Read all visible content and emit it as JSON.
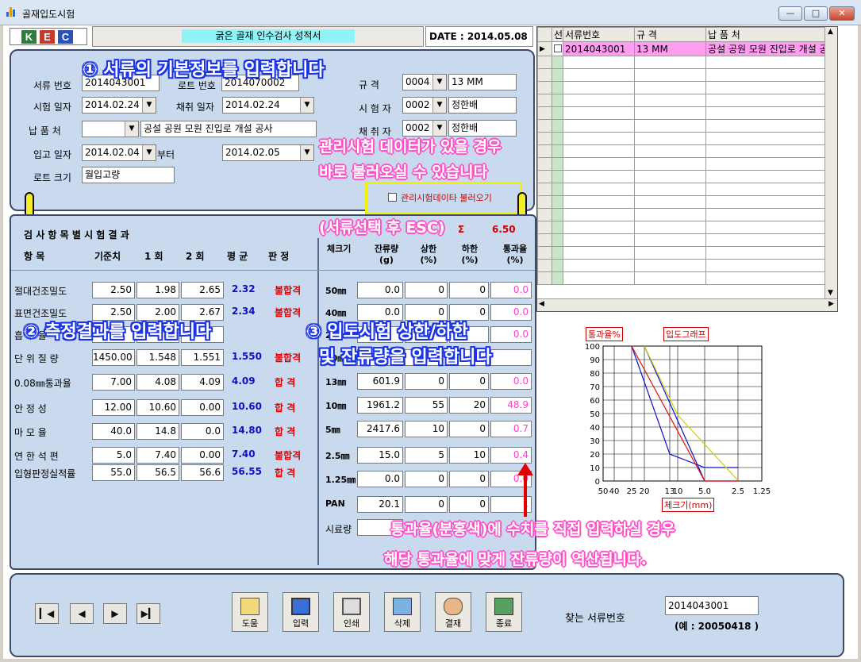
{
  "window": {
    "title": "골재입도시험",
    "btn_min": "—",
    "btn_max": "□",
    "btn_close": "✕"
  },
  "header": {
    "logo": [
      "K",
      "E",
      "C"
    ],
    "logo_colors": [
      "#2f7d3a",
      "#c43a2d",
      "#2b52b8"
    ],
    "title": "굵은 골재 인수검사 성적서",
    "date_label": "DATE : 2014.05.08"
  },
  "basic": {
    "doc_no_label": "서류 번호",
    "doc_no": "2014043001",
    "lot_no_label": "로트 번호",
    "lot_no": "2014070002",
    "test_date_label": "시험 일자",
    "test_date": "2014.02.24",
    "sample_date_label": "채취 일자",
    "sample_date": "2014.02.24",
    "supplier_label": "납 품 처",
    "supplier_code": "",
    "supplier_name": "공설 공원 모원 진입로 개설 공사",
    "in_date_label": "입고 일자",
    "in_date_from": "2014.02.04",
    "in_date_from_suffix": "부터",
    "in_date_to": "2014.02.05",
    "lot_size_label": "로트 크기",
    "lot_size": "월입고량",
    "spec_label": "규 격",
    "spec_code": "0004",
    "spec_name": "13 MM",
    "tester_label": "시 험 자",
    "tester_code": "0002",
    "tester_name": "정한배",
    "sampler_label": "채 취 자",
    "sampler_code": "0002",
    "sampler_name": "정한배",
    "load_checkbox_label": "관리시험데이타 불러오기"
  },
  "results": {
    "section_title": "검 사 항 목 별  시 험 결 과",
    "headers": [
      "항 목",
      "기준치",
      "1 회",
      "2 회",
      "평 균",
      "판 정"
    ],
    "rows": [
      {
        "name": "절대건조밀도",
        "std": "2.50",
        "r1": "1.98",
        "r2": "2.65",
        "avg": "2.32",
        "judge": "불합격"
      },
      {
        "name": "표면건조밀도",
        "std": "2.50",
        "r1": "2.00",
        "r2": "2.67",
        "avg": "2.34",
        "judge": "불합격"
      },
      {
        "name": "흡 수 율",
        "std": "",
        "r1": "",
        "r2": "",
        "avg": "",
        "judge": ""
      },
      {
        "name": "단 위 질 량",
        "std": "1450.00",
        "r1": "1.548",
        "r2": "1.551",
        "avg": "1.550",
        "judge": "불합격"
      },
      {
        "name": "0.08㎜통과율",
        "std": "7.00",
        "r1": "4.08",
        "r2": "4.09",
        "avg": "4.09",
        "judge": "합 격"
      },
      {
        "name": "안 정 성",
        "std": "12.00",
        "r1": "10.60",
        "r2": "0.00",
        "avg": "10.60",
        "judge": "합 격"
      },
      {
        "name": "마 모 율",
        "std": "40.0",
        "r1": "14.8",
        "r2": "0.0",
        "avg": "14.80",
        "judge": "합 격"
      },
      {
        "name": "연 한 석 편",
        "std": "5.0",
        "r1": "7.40",
        "r2": "0.00",
        "avg": "7.40",
        "judge": "불합격"
      },
      {
        "name": "입형판정실적률",
        "std": "55.0",
        "r1": "56.5",
        "r2": "56.6",
        "avg": "56.55",
        "judge": "합 격"
      }
    ]
  },
  "sieve": {
    "fm_label": "Σ",
    "fm_value": "6.50",
    "headers": [
      "체크기",
      "잔류량\n(g)",
      "상한\n(%)",
      "하한\n(%)",
      "통과율\n(%)"
    ],
    "rows": [
      {
        "size": "50㎜",
        "residue": "0.0",
        "upper": "0",
        "lower": "0",
        "pass": "0.0"
      },
      {
        "size": "40㎜",
        "residue": "0.0",
        "upper": "0",
        "lower": "0",
        "pass": "0.0"
      },
      {
        "size": "25㎜",
        "residue": "",
        "upper": "",
        "lower": "",
        "pass": "0.0"
      },
      {
        "size": "20㎜",
        "residue": "",
        "upper": "",
        "lower": "",
        "pass": ""
      },
      {
        "size": "13㎜",
        "residue": "601.9",
        "upper": "0",
        "lower": "0",
        "pass": "0.0"
      },
      {
        "size": "10㎜",
        "residue": "1961.2",
        "upper": "55",
        "lower": "20",
        "pass": "48.9"
      },
      {
        "size": "5㎜",
        "residue": "2417.6",
        "upper": "10",
        "lower": "0",
        "pass": "0.7"
      },
      {
        "size": "2.5㎜",
        "residue": "15.0",
        "upper": "5",
        "lower": "10",
        "pass": "0.4"
      },
      {
        "size": "1.25㎜",
        "residue": "0.0",
        "upper": "0",
        "lower": "0",
        "pass": "0.0"
      },
      {
        "size": "PAN",
        "residue": "20.1",
        "upper": "0",
        "lower": "0",
        "pass": "."
      }
    ],
    "sample_label": "시료량"
  },
  "grid": {
    "headers": [
      "선",
      "서류번호",
      "규 격",
      "납 품 처"
    ],
    "rows": [
      {
        "doc": "2014043001",
        "spec": "13 MM",
        "supplier": "공설 공원 모원 진입로 개설 공"
      }
    ]
  },
  "chart_data": {
    "type": "line",
    "title": "입도그래프",
    "ylabel": "통과율%",
    "xlabel": "체크기(mm)",
    "x_ticks": [
      "50",
      "40",
      "25",
      "20",
      "13",
      "10",
      "5.0",
      "2.5",
      "1.25"
    ],
    "y_ticks": [
      "100",
      "90",
      "80",
      "70",
      "60",
      "50",
      "40",
      "30",
      "20",
      "10",
      "0"
    ],
    "ylim": [
      0,
      100
    ],
    "series": [
      {
        "color": "#1010d0",
        "x": [
          "25",
          "13",
          "5.0",
          "2.5"
        ],
        "values": [
          100,
          20,
          10,
          10
        ]
      },
      {
        "color": "#1010d0",
        "x": [
          "20",
          "5.0",
          "2.5"
        ],
        "values": [
          100,
          0,
          0
        ]
      },
      {
        "color": "#e01010",
        "x": [
          "25",
          "5.0",
          "2.5"
        ],
        "values": [
          100,
          0,
          0
        ]
      },
      {
        "color": "#d0d000",
        "x": [
          "20",
          "10",
          "2.5"
        ],
        "values": [
          100,
          48.9,
          0.4
        ]
      }
    ]
  },
  "annotations": {
    "a1": "① 서류의 기본정보를 입력합니다",
    "a2": "② 측정결과를 입력합니다",
    "a3_line1": "③ 입도시험 상한/하한",
    "a3_line2": "및 잔류량을 입력합니다",
    "mgmt_line1": "관리시험 데이터가 있을 경우",
    "mgmt_line2": "바로 불러오실 수 있습니다",
    "mgmt_line3": "(서류선택 후 ESC)",
    "pass_line1": "통과율(분홍색)에 수치를 직접 입력하실 경우",
    "pass_line2": "해당 통과율에 맞게 잔류량이 역산됩니다."
  },
  "toolbar": {
    "help": "도움",
    "input": "입력",
    "print": "인쇄",
    "delete": "삭제",
    "approve": "결재",
    "exit": "종료",
    "search_label": "찾는 서류번호",
    "search_value": "2014043001",
    "search_example": "(예 : 20050418 )"
  }
}
